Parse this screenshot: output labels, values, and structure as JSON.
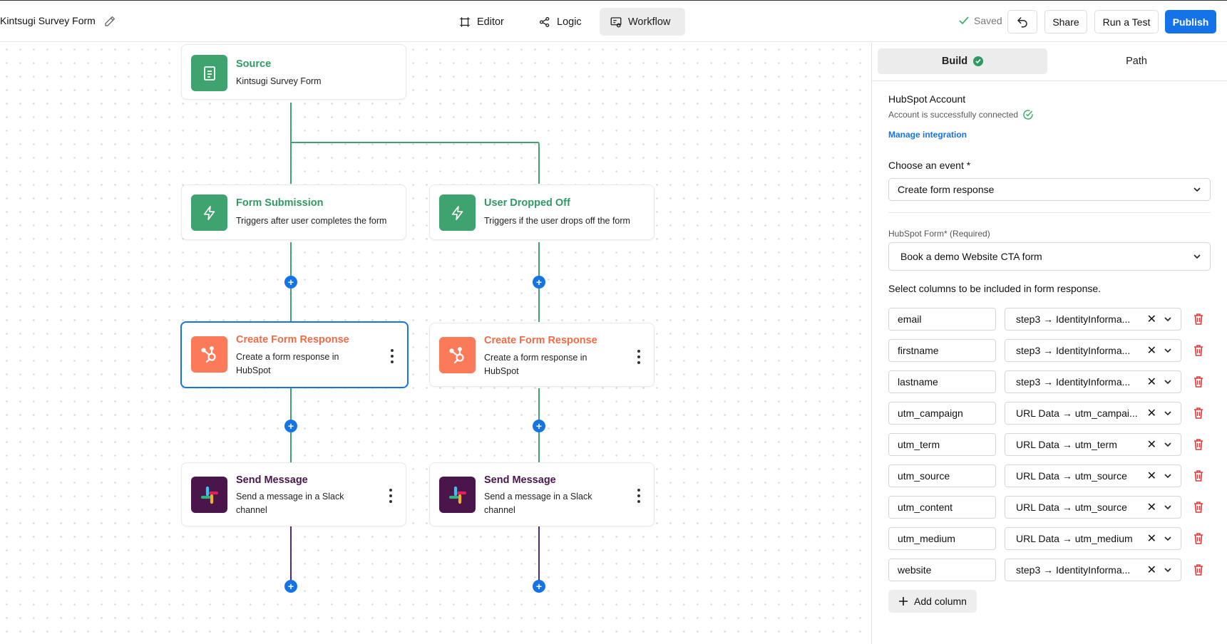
{
  "header": {
    "form_title": "Kintsugi Survey Form",
    "tabs": [
      {
        "label": "Editor",
        "icon": "frame-icon"
      },
      {
        "label": "Logic",
        "icon": "share-nodes-icon"
      },
      {
        "label": "Workflow",
        "icon": "workflow-icon"
      }
    ],
    "active_tab": "Workflow",
    "saved_label": "Saved",
    "share_label": "Share",
    "run_test_label": "Run a Test",
    "publish_label": "Publish"
  },
  "workflow": {
    "source": {
      "title": "Source",
      "subtitle": "Kintsugi Survey Form"
    },
    "triggers": [
      {
        "title": "Form Submission",
        "description": "Triggers after user completes the form"
      },
      {
        "title": "User Dropped Off",
        "description": "Triggers if the user drops off the form"
      }
    ],
    "hubspot_actions": [
      {
        "title": "Create Form Response",
        "description": "Create a form response in HubSpot"
      },
      {
        "title": "Create Form Response",
        "description": "Create a form response in HubSpot"
      }
    ],
    "slack_actions": [
      {
        "title": "Send Message",
        "description": "Send a message in a Slack channel"
      },
      {
        "title": "Send Message",
        "description": "Send a message in a Slack channel"
      }
    ],
    "add_symbol": "+"
  },
  "panel": {
    "tabs": [
      {
        "label": "Build"
      },
      {
        "label": "Path"
      }
    ],
    "active_tab": "Build",
    "account_heading": "HubSpot Account",
    "account_status": "Account is successfully connected",
    "manage_link": "Manage integration",
    "event_label": "Choose an event *",
    "event_value": "Create form response",
    "form_label": "HubSpot Form* (Required)",
    "form_value": "Book a demo Website CTA form",
    "columns_label": "Select columns to be included in form response.",
    "columns": [
      {
        "field": "email",
        "mapping": "step3 → IdentityInforma..."
      },
      {
        "field": "firstname",
        "mapping": "step3 → IdentityInforma..."
      },
      {
        "field": "lastname",
        "mapping": "step3 → IdentityInforma..."
      },
      {
        "field": "utm_campaign",
        "mapping": "URL Data → utm_campai..."
      },
      {
        "field": "utm_term",
        "mapping": "URL Data → utm_term"
      },
      {
        "field": "utm_source",
        "mapping": "URL Data → utm_source"
      },
      {
        "field": "utm_content",
        "mapping": "URL Data → utm_source"
      },
      {
        "field": "utm_medium",
        "mapping": "URL Data → utm_medium"
      },
      {
        "field": "website",
        "mapping": "step3 → IdentityInforma..."
      }
    ],
    "remove_symbol": "✕",
    "add_column_label": "Add column"
  },
  "colors": {
    "accent": "#1473e6",
    "trigger_green": "#3ea36f",
    "hubspot_orange": "#fb7a59",
    "slack_purple": "#4a154b",
    "delete_red": "#e03a3a"
  }
}
